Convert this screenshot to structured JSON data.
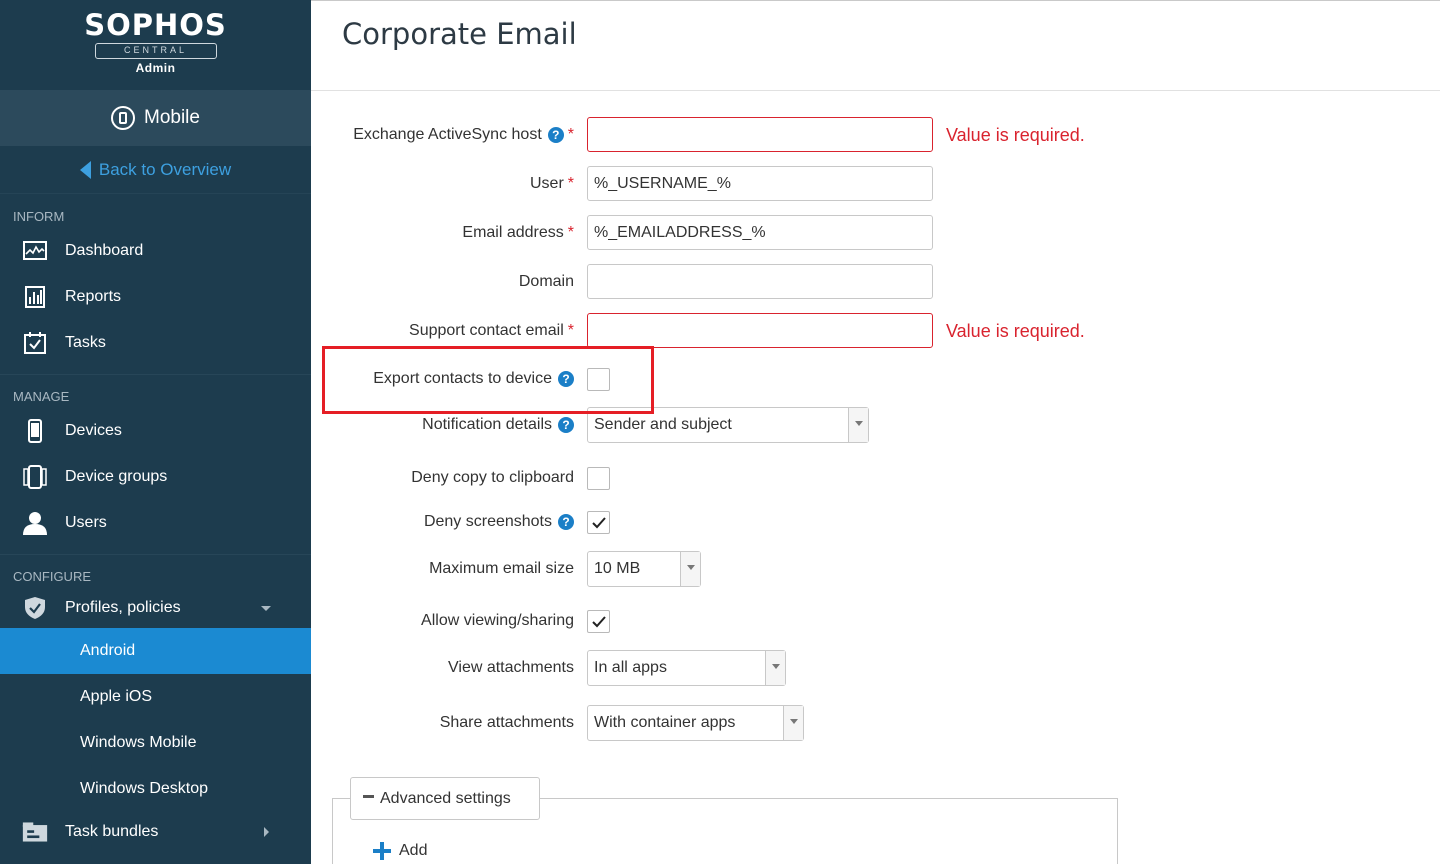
{
  "sidebar": {
    "logo": {
      "brand": "SOPHOS",
      "sub": "CENTRAL",
      "role": "Admin"
    },
    "product": "Mobile",
    "back_label": "Back to Overview",
    "sections": {
      "inform": "INFORM",
      "manage": "MANAGE",
      "configure": "CONFIGURE"
    },
    "inform_items": [
      {
        "label": "Dashboard",
        "icon": "dashboard-icon"
      },
      {
        "label": "Reports",
        "icon": "reports-icon"
      },
      {
        "label": "Tasks",
        "icon": "tasks-icon"
      }
    ],
    "manage_items": [
      {
        "label": "Devices",
        "icon": "device-icon"
      },
      {
        "label": "Device groups",
        "icon": "device-groups-icon"
      },
      {
        "label": "Users",
        "icon": "user-icon"
      }
    ],
    "configure": {
      "profiles_label": "Profiles, policies",
      "sub_items": [
        "Android",
        "Apple iOS",
        "Windows Mobile",
        "Windows Desktop"
      ],
      "active_sub_item": "Android",
      "task_bundles_label": "Task bundles"
    }
  },
  "page": {
    "title": "Corporate Email"
  },
  "form": {
    "exchange_host": {
      "label": "Exchange ActiveSync host",
      "value": "",
      "error": "Value is required."
    },
    "user": {
      "label": "User",
      "value": "%_USERNAME_%"
    },
    "email": {
      "label": "Email address",
      "value": "%_EMAILADDRESS_%"
    },
    "domain": {
      "label": "Domain",
      "value": ""
    },
    "support_email": {
      "label": "Support contact email",
      "value": "",
      "error": "Value is required."
    },
    "export_contacts": {
      "label": "Export contacts to device",
      "checked": false
    },
    "notification_details": {
      "label": "Notification details",
      "selected": "Sender and subject"
    },
    "deny_clipboard": {
      "label": "Deny copy to clipboard",
      "checked": false
    },
    "deny_screenshots": {
      "label": "Deny screenshots",
      "checked": true
    },
    "max_email_size": {
      "label": "Maximum email size",
      "selected": "10 MB"
    },
    "allow_viewing": {
      "label": "Allow viewing/sharing",
      "checked": true
    },
    "view_attachments": {
      "label": "View attachments",
      "selected": "In all apps"
    },
    "share_attachments": {
      "label": "Share attachments",
      "selected": "With container apps"
    }
  },
  "advanced": {
    "toggle_label": "Advanced settings",
    "add_label": "Add"
  },
  "colors": {
    "sidebar_bg": "#1d3c4e",
    "active_blue": "#1b8ad2",
    "error_red": "#d9232e",
    "highlight_red": "#e51e25"
  }
}
